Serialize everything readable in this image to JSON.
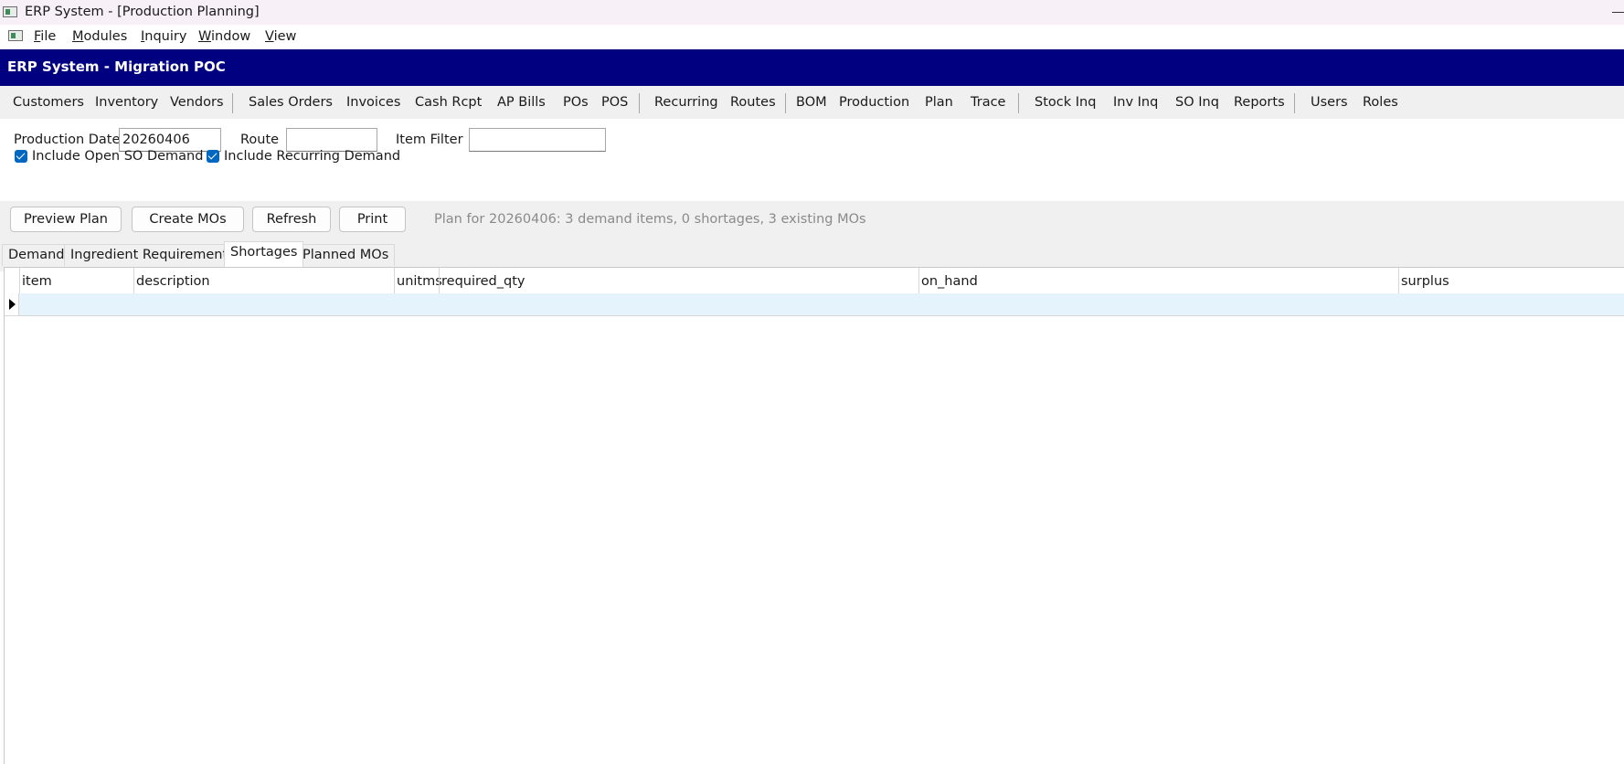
{
  "window": {
    "title": "ERP System - [Production Planning]"
  },
  "menu": {
    "items": [
      "File",
      "Modules",
      "Inquiry",
      "Window",
      "View"
    ]
  },
  "banner": {
    "title": "ERP System - Migration POC",
    "bg_color": "#000080"
  },
  "modules": {
    "items": [
      "Customers",
      "Inventory",
      "Vendors",
      "Sales Orders",
      "Invoices",
      "Cash Rcpt",
      "AP Bills",
      "POs",
      "POS",
      "Recurring",
      "Routes",
      "BOM",
      "Production",
      "Plan",
      "Trace",
      "Stock Inq",
      "Inv Inq",
      "SO Inq",
      "Reports",
      "Users",
      "Roles"
    ]
  },
  "filters": {
    "production_date_label": "Production Date",
    "production_date_value": "20260406",
    "route_label": "Route",
    "route_value": "",
    "item_filter_label": "Item Filter",
    "item_filter_value": "",
    "include_open_so_label": "Include Open SO Demand",
    "include_open_so_checked": true,
    "include_recurring_label": "Include Recurring Demand",
    "include_recurring_checked": true
  },
  "toolbar": {
    "preview_label": "Preview Plan",
    "create_mos_label": "Create MOs",
    "refresh_label": "Refresh",
    "print_label": "Print",
    "status": "Plan for 20260406: 3 demand items, 0 shortages, 3 existing MOs"
  },
  "tabs": {
    "items": [
      "Demand",
      "Ingredient Requirements",
      "Shortages",
      "Planned MOs"
    ],
    "active": "Shortages"
  },
  "grid": {
    "columns": [
      "item",
      "description",
      "unitms",
      "required_qty",
      "on_hand",
      "surplus"
    ],
    "rows": []
  }
}
